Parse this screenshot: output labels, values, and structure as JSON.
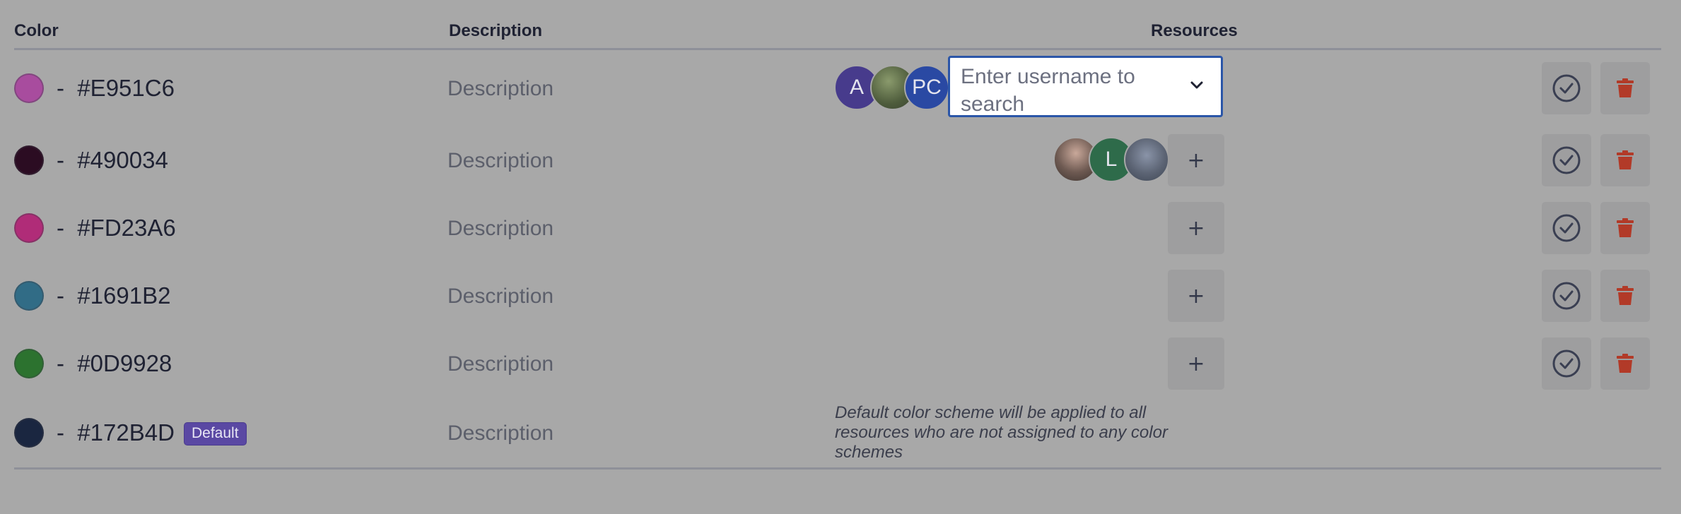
{
  "table": {
    "headers": {
      "color": "Color",
      "description": "Description",
      "resources": "Resources"
    },
    "rows": [
      {
        "swatch": "#a84c9e",
        "hex_label": "-  #E951C6",
        "description": "Description",
        "resources": {
          "avatars": [
            {
              "initials": "A",
              "color": "#473b8c"
            },
            {
              "initials": "",
              "color": "#5a6a48",
              "kind": "photo"
            },
            {
              "initials": "PC",
              "color": "#2a49a3"
            }
          ],
          "search": {
            "placeholder": "Enter username to search"
          }
        }
      },
      {
        "swatch": "#2b0c22",
        "hex_label": "-  #490034",
        "description": "Description",
        "resources": {
          "avatars": [
            {
              "initials": "",
              "color": "#7a6e68",
              "kind": "photo"
            },
            {
              "initials": "L",
              "color": "#2e6b4a"
            },
            {
              "initials": "",
              "color": "#5c6474",
              "kind": "photo"
            }
          ],
          "add_label": "+"
        }
      },
      {
        "swatch": "#b02c78",
        "hex_label": "-  #FD23A6",
        "description": "Description",
        "resources": {
          "add_label": "+"
        }
      },
      {
        "swatch": "#316c86",
        "hex_label": "-  #1691B2",
        "description": "Description",
        "resources": {
          "add_label": "+"
        }
      },
      {
        "swatch": "#2c722f",
        "hex_label": "-  #0D9928",
        "description": "Description",
        "resources": {
          "add_label": "+"
        }
      },
      {
        "swatch": "#1a2640",
        "hex_label": "-  #172B4D",
        "badge": "Default",
        "description": "Description",
        "resources": {
          "note": "Default color scheme will be applied to all resources who are not assigned to any color schemes"
        }
      }
    ],
    "actions": {
      "confirm_icon": "check-circle-icon",
      "delete_icon": "trash-icon",
      "delete_color": "#b23a28",
      "confirm_color": "#3a3f52"
    }
  }
}
